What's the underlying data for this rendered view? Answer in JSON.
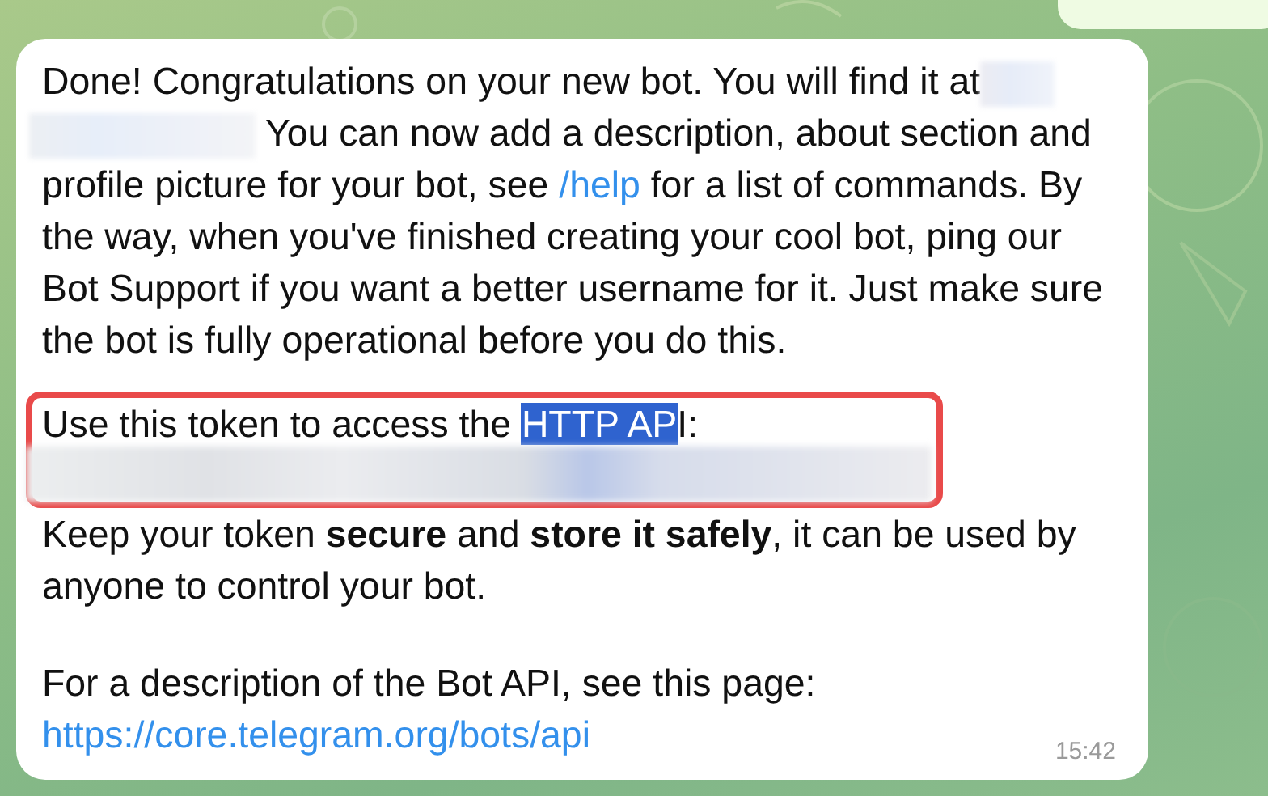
{
  "message": {
    "intro": {
      "before_redaction": "Done! Congratulations on your new bot. You will find it at",
      "after_redaction": " You can now add a description, about section and profile picture for your bot, see ",
      "link": "/help",
      "after_link": " for a list of commands. By the way, when you've finished creating your cool bot, ping our Bot Support if you want a better username for it. Just make sure the bot is fully operational before you do this."
    },
    "token_line": [
      {
        "text": "Use this token to access the ",
        "selected": false
      },
      {
        "text": "HTTP AP",
        "selected": true
      },
      {
        "text": "I:",
        "selected": false
      }
    ],
    "warning": "Keep your token **secure** and **store it safely**, it can be used by anyone to control your bot.",
    "api_line": {
      "text": "For a description of the Bot API, see this page: ",
      "link": "https://core.telegram.org/bots/api"
    },
    "time": "15:42"
  }
}
